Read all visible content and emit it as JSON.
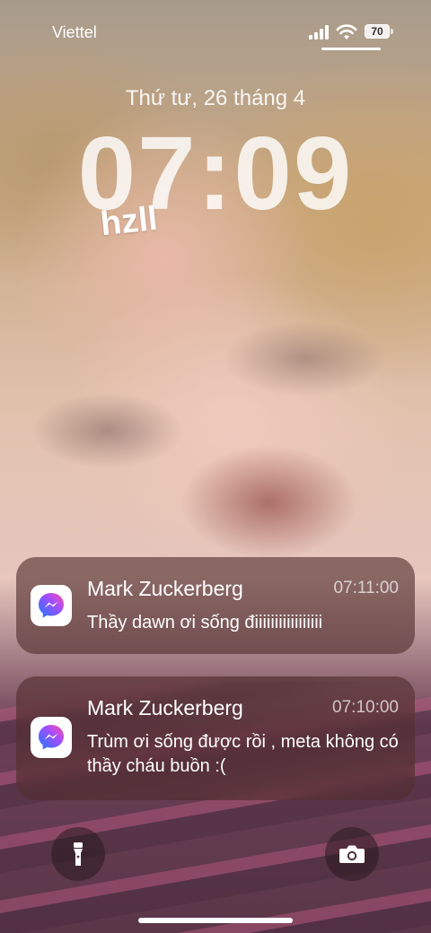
{
  "status_bar": {
    "carrier": "Viettel",
    "battery": "70",
    "icons": [
      "signal-icon",
      "wifi-icon",
      "battery-icon"
    ]
  },
  "lockscreen": {
    "date": "Thứ tư, 26 tháng 4",
    "time": "07:09",
    "sticker": "hzll"
  },
  "notifications": [
    {
      "app_icon": "messenger-icon",
      "sender": "Mark Zuckerberg",
      "time": "07:11:00",
      "message": "Thầy dawn ơi sống điiiiiiiiiiiiiiiii"
    },
    {
      "app_icon": "messenger-icon",
      "sender": "Mark Zuckerberg",
      "time": "07:10:00",
      "message": "Trùm ơi sống được rồi , meta không có thầy cháu buồn :("
    }
  ],
  "controls": {
    "left": "flashlight-icon",
    "right": "camera-icon"
  },
  "colors": {
    "messenger_gradient_start": "#1a7bff",
    "messenger_gradient_end": "#ff4fa0",
    "notification_bg": "#502d2d"
  }
}
